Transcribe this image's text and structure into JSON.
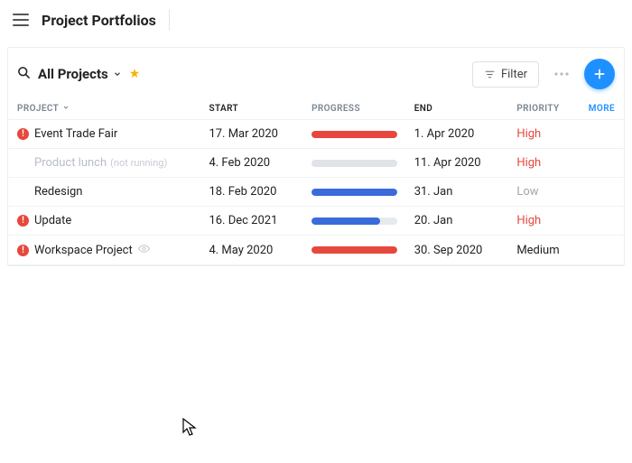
{
  "header": {
    "title": "Project Portfolios"
  },
  "toolbar": {
    "view_title": "All Projects",
    "filter_label": "Filter"
  },
  "columns": {
    "project": "PROJECT",
    "start": "START",
    "progress": "PROGRESS",
    "end": "END",
    "priority": "PRIORITY",
    "more": "MORE"
  },
  "projects": [
    {
      "name": "Event Trade Fair",
      "alert": true,
      "muted": false,
      "not_running": false,
      "eye": false,
      "start": "17. Mar 2020",
      "end": "1. Apr 2020",
      "progress_pct": 100,
      "progress_color": "#e7473c",
      "priority": "High",
      "priority_class": "prio-high"
    },
    {
      "name": "Product lunch",
      "alert": false,
      "muted": true,
      "not_running": true,
      "not_running_label": "(not running)",
      "eye": false,
      "start": "4. Feb 2020",
      "end": "11. Apr 2020",
      "progress_pct": 100,
      "progress_color": "#e0e4e8",
      "priority": "High",
      "priority_class": "prio-high"
    },
    {
      "name": "Redesign",
      "alert": false,
      "muted": false,
      "not_running": false,
      "eye": false,
      "start": "18. Feb 2020",
      "end": "31. Jan",
      "progress_pct": 100,
      "progress_color": "#3a6bdb",
      "priority": "Low",
      "priority_class": "prio-low"
    },
    {
      "name": "Update",
      "alert": true,
      "muted": false,
      "not_running": false,
      "eye": false,
      "start": "16. Dec 2021",
      "end": "20. Jan",
      "progress_pct": 80,
      "progress_color": "#3a6bdb",
      "priority": "High",
      "priority_class": "prio-high"
    },
    {
      "name": "Workspace Project",
      "alert": true,
      "muted": false,
      "not_running": false,
      "eye": true,
      "start": "4. May 2020",
      "end": "30. Sep 2020",
      "progress_pct": 100,
      "progress_color": "#e7473c",
      "priority": "Medium",
      "priority_class": "prio-medium"
    }
  ]
}
